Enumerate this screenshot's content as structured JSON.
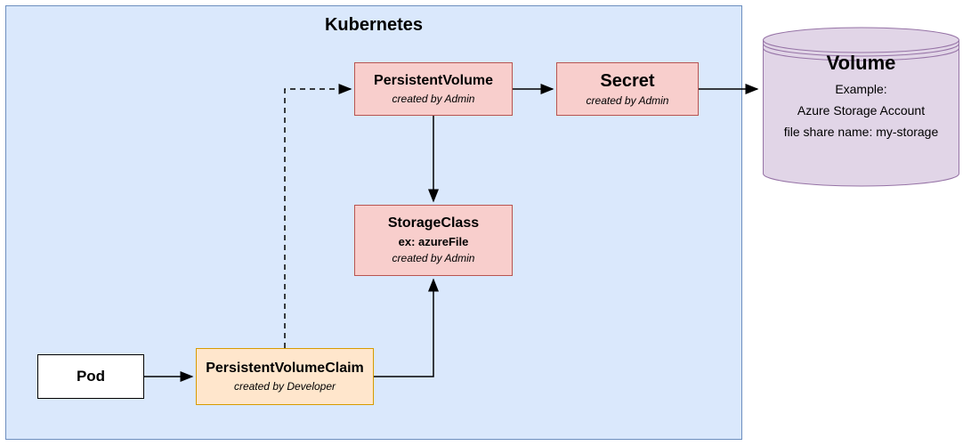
{
  "k8s": {
    "title": "Kubernetes"
  },
  "pod": {
    "title": "Pod"
  },
  "pvc": {
    "title": "PersistentVolumeClaim",
    "sub": "created by Developer"
  },
  "pv": {
    "title": "PersistentVolume",
    "sub": "created by Admin"
  },
  "sc": {
    "title": "StorageClass",
    "mid": "ex: azureFile",
    "sub": "created by Admin"
  },
  "secret": {
    "title": "Secret",
    "sub": "created by Admin"
  },
  "volume": {
    "title": "Volume",
    "line1": "Example:",
    "line2": "Azure Storage Account",
    "line3": "file share name: my-storage"
  }
}
